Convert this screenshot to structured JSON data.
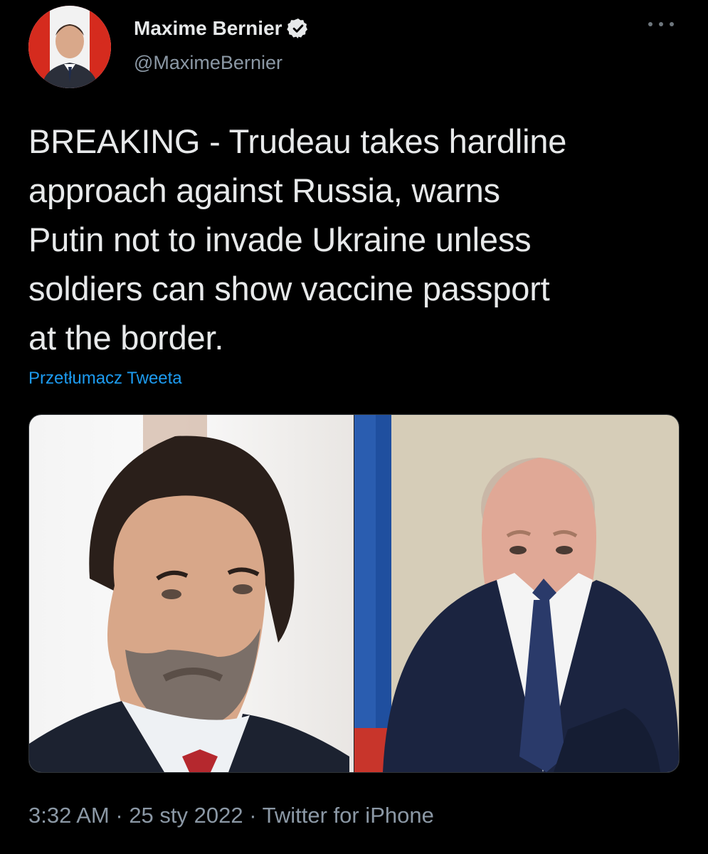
{
  "author": {
    "name": "Maxime Bernier",
    "handle": "@MaximeBernier",
    "verified": true,
    "avatar_icon": "user-avatar-photo"
  },
  "tweet": {
    "text": "BREAKING - Trudeau takes hardline\napproach against Russia, warns\nPutin not to invade Ukraine unless\nsoldiers can show vaccine passport\nat the border.",
    "translate_label": "Przetłumacz Tweeta",
    "media": [
      {
        "icon": "portrait-photo"
      },
      {
        "icon": "portrait-photo"
      }
    ]
  },
  "meta": {
    "time": "3:32 AM",
    "date": "25 sty 2022",
    "source": "Twitter for iPhone",
    "separator": " · "
  },
  "icons": {
    "verified": "verified-badge-icon",
    "more": "more-options-icon"
  },
  "colors": {
    "background": "#000000",
    "text_primary": "#e7e9ea",
    "text_secondary": "#8b98a5",
    "link": "#1d9bf0"
  }
}
